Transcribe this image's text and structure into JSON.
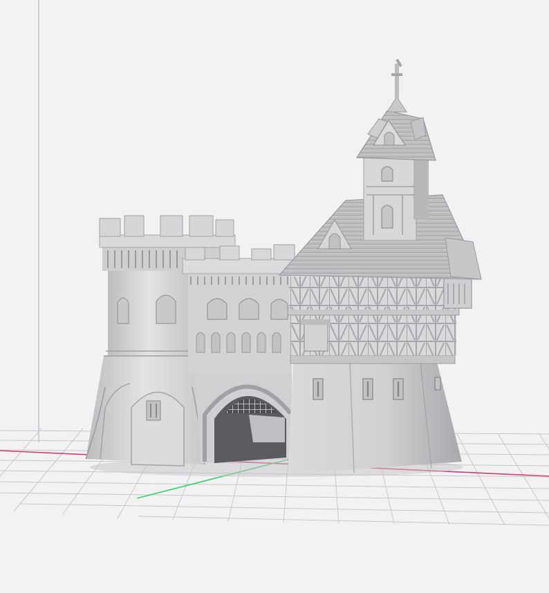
{
  "viewport": {
    "background": "#f2f2f3",
    "bed_grid_color": "#c7c8cc",
    "axis_x_color": "#d23c6e",
    "axis_y_color": "#37d467",
    "vertical_axis_color": "#b9b9bd",
    "model_color": "#d4d4d6"
  },
  "model": {
    "name_icon": "castle-gatehouse-model"
  }
}
